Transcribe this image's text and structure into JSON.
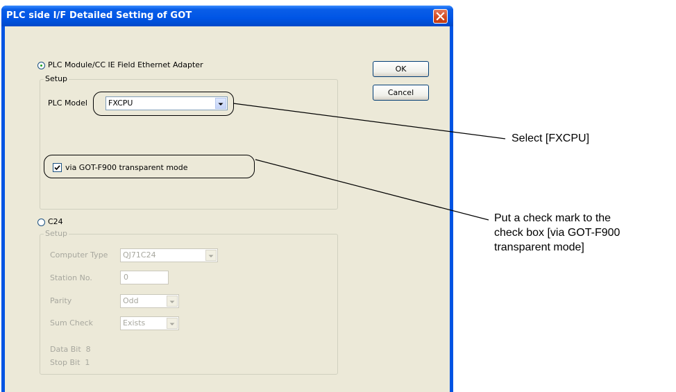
{
  "window": {
    "title": "PLC side I/F Detailed Setting of GOT"
  },
  "option_plc_module": {
    "label": "PLC Module/CC IE Field Ethernet Adapter",
    "selected": true
  },
  "setup_group_1": {
    "legend": "Setup",
    "plc_model_label": "PLC Model",
    "plc_model_value": "FXCPU",
    "transparent_mode_label": "via GOT-F900 transparent mode",
    "transparent_mode_checked": true
  },
  "buttons": {
    "ok": "OK",
    "cancel": "Cancel"
  },
  "option_c24": {
    "label": "C24",
    "selected": false
  },
  "setup_group_2": {
    "legend": "Setup",
    "computer_type_label": "Computer Type",
    "computer_type_value": "QJ71C24",
    "station_no_label": "Station No.",
    "station_no_value": "0",
    "parity_label": "Parity",
    "parity_value": "Odd",
    "sum_check_label": "Sum Check",
    "sum_check_value": "Exists",
    "data_bit": "Data Bit  8",
    "stop_bit": "Stop Bit  1"
  },
  "annotations": {
    "select_fxcpu": "Select [FXCPU]",
    "check_mark_line1": "Put a check mark to the",
    "check_mark_line2": "check box [via GOT-F900",
    "check_mark_line3": "transparent mode]"
  },
  "colors": {
    "title_bar": "#0055e5",
    "dialog_face": "#ece9d8",
    "disabled_text": "#a7a79e",
    "close_button": "#d24b21"
  }
}
